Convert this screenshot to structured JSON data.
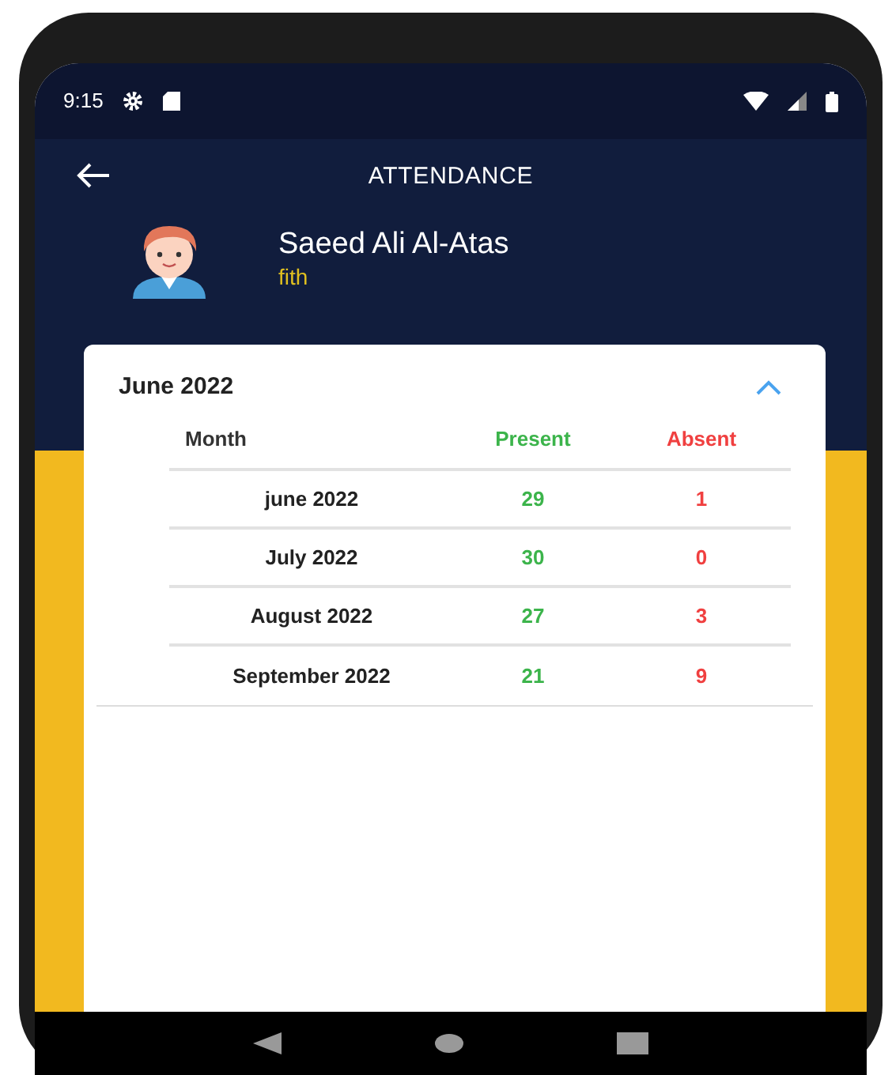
{
  "status_bar": {
    "time": "9:15"
  },
  "header": {
    "title": "ATTENDANCE"
  },
  "student": {
    "name": "Saeed Ali Al-Atas",
    "grade": "fith"
  },
  "card": {
    "title": "June 2022",
    "expanded": true,
    "columns": [
      "Month",
      "Present",
      "Absent"
    ],
    "rows": [
      {
        "month": "june 2022",
        "present": "29",
        "absent": "1"
      },
      {
        "month": "July 2022",
        "present": "30",
        "absent": "0"
      },
      {
        "month": "August 2022",
        "present": "27",
        "absent": "3"
      },
      {
        "month": "September 2022",
        "present": "21",
        "absent": "9"
      }
    ]
  }
}
